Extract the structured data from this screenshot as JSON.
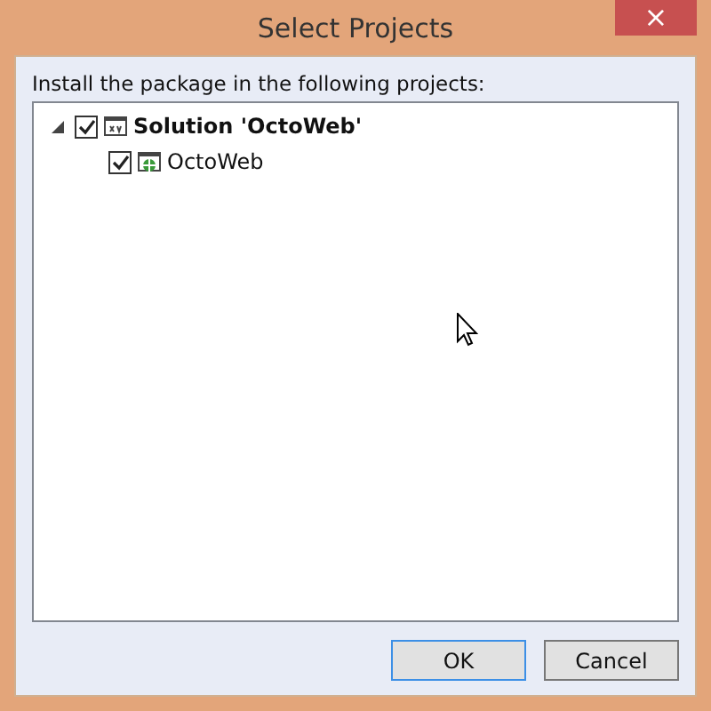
{
  "window": {
    "title": "Select Projects",
    "close": "×"
  },
  "prompt": "Install the package in the following projects:",
  "tree": [
    {
      "label": "Solution 'OctoWeb'",
      "kind": "solution",
      "expanded": true,
      "checked": true,
      "children": [
        {
          "label": "OctoWeb",
          "kind": "web-project",
          "checked": true
        }
      ]
    }
  ],
  "buttons": [
    {
      "label": "OK",
      "focused": true
    },
    {
      "label": "Cancel",
      "focused": false
    }
  ]
}
